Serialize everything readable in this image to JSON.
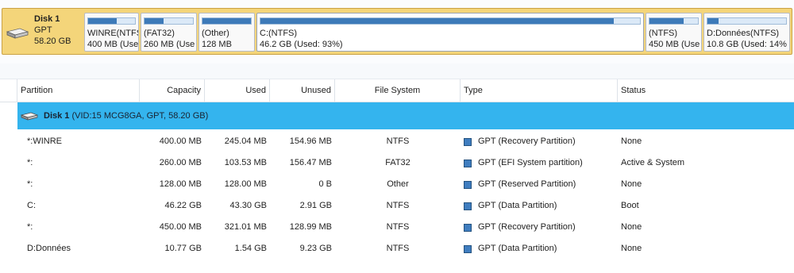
{
  "disk_map": {
    "disk": {
      "name": "Disk 1",
      "type": "GPT",
      "size": "58.20 GB"
    },
    "partitions": [
      {
        "label": "WINRE(NTFS",
        "info": "400 MB (Use",
        "used_fraction": 0.61
      },
      {
        "label": "(FAT32)",
        "info": "260 MB (Use",
        "used_fraction": 0.4
      },
      {
        "label": "(Other)",
        "info": "128 MB",
        "used_fraction": 1.0
      },
      {
        "label": "C:(NTFS)",
        "info": "46.2 GB (Used: 93%)",
        "used_fraction": 0.93
      },
      {
        "label": "(NTFS)",
        "info": "450 MB (Use",
        "used_fraction": 0.71
      },
      {
        "label": "D:Données(NTFS)",
        "info": "10.8 GB (Used: 14%",
        "used_fraction": 0.14
      }
    ]
  },
  "table": {
    "columns": {
      "partition": "Partition",
      "capacity": "Capacity",
      "used": "Used",
      "unused": "Unused",
      "file_system": "File System",
      "type": "Type",
      "status": "Status"
    },
    "disk_row": {
      "name": "Disk 1",
      "details": "(VID:15 MCG8GA, GPT, 58.20 GB)"
    },
    "rows": [
      {
        "partition": "*:WINRE",
        "capacity": "400.00 MB",
        "used": "245.04 MB",
        "unused": "154.96 MB",
        "file_system": "NTFS",
        "type": "GPT (Recovery Partition)",
        "status": "None"
      },
      {
        "partition": "*:",
        "capacity": "260.00 MB",
        "used": "103.53 MB",
        "unused": "156.47 MB",
        "file_system": "FAT32",
        "type": "GPT (EFI System partition)",
        "status": "Active & System"
      },
      {
        "partition": "*:",
        "capacity": "128.00 MB",
        "used": "128.00 MB",
        "unused": "0 B",
        "file_system": "Other",
        "type": "GPT (Reserved Partition)",
        "status": "None"
      },
      {
        "partition": "C:",
        "capacity": "46.22 GB",
        "used": "43.30 GB",
        "unused": "2.91 GB",
        "file_system": "NTFS",
        "type": "GPT (Data Partition)",
        "status": "Boot"
      },
      {
        "partition": "*:",
        "capacity": "450.00 MB",
        "used": "321.01 MB",
        "unused": "128.99 MB",
        "file_system": "NTFS",
        "type": "GPT (Recovery Partition)",
        "status": "None"
      },
      {
        "partition": "D:Données",
        "capacity": "10.77 GB",
        "used": "1.54 GB",
        "unused": "9.23 GB",
        "file_system": "NTFS",
        "type": "GPT (Data Partition)",
        "status": "None"
      }
    ]
  },
  "colors": {
    "disk_card": "#f4d57a",
    "selected_row": "#34b4ee",
    "usage_fill": "#3d7ab9",
    "type_marker": "#3f7dbf"
  },
  "icons": {
    "disk": "hard-drive-icon",
    "type_marker": "partition-type-square-icon"
  }
}
